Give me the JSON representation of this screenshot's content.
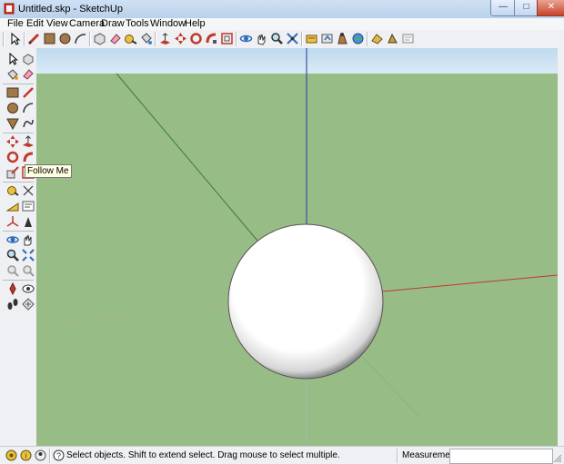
{
  "window": {
    "title": "Untitled.skp - SketchUp",
    "controls": {
      "minimize": "—",
      "maximize": "□",
      "close": "✕"
    }
  },
  "menu": [
    "File",
    "Edit",
    "View",
    "Camera",
    "Draw",
    "Tools",
    "Window",
    "Help"
  ],
  "toolbar_top": {
    "tools": [
      "select-arrow",
      "pencil-line",
      "rectangle",
      "circle",
      "arc",
      "make-component",
      "eraser",
      "tape-measure",
      "paint-bucket",
      "push-pull",
      "move",
      "rotate",
      "follow-me",
      "offset",
      "orbit",
      "pan",
      "zoom",
      "zoom-extents",
      "get-models",
      "share-model",
      "components",
      "get-photo-texture",
      "google-earth",
      "place-model",
      "add-location",
      "toggle-terrain"
    ]
  },
  "toolbar_left": {
    "tools": [
      "select",
      "make-component",
      "paint-bucket",
      "eraser",
      "rectangle",
      "line",
      "circle",
      "arc",
      "polygon",
      "freehand",
      "move",
      "push-pull",
      "rotate",
      "follow-me",
      "scale",
      "offset",
      "tape-measure",
      "dimension",
      "protractor",
      "text",
      "axes",
      "3d-text",
      "orbit",
      "pan",
      "zoom",
      "zoom-window",
      "previous-view",
      "next-view",
      "position-camera",
      "look-around",
      "walk",
      "section-plane"
    ]
  },
  "tooltip": "Follow Me",
  "status": {
    "hint": "Select objects. Shift to extend select. Drag mouse to select multiple.",
    "measurements_label": "Measurements",
    "measurements_value": ""
  },
  "colors": {
    "ground": "#97bc86",
    "sky": "#c8e0f2",
    "blue_axis": "#3a55a0",
    "red_axis": "#c0392b",
    "green_axis": "#3c8a3c"
  }
}
